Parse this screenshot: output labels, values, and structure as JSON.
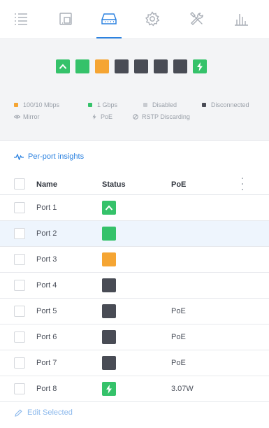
{
  "colors": {
    "accent": "#2c82e0",
    "port_100_10": "#f5a533",
    "port_1g": "#35c26a",
    "port_disabled": "#c8cbd0",
    "port_disconnected": "#494c55"
  },
  "tabs": [
    {
      "name": "list-icon",
      "active": false
    },
    {
      "name": "devices-icon",
      "active": false
    },
    {
      "name": "switch-ports-icon",
      "active": true
    },
    {
      "name": "gear-icon",
      "active": false
    },
    {
      "name": "tools-icon",
      "active": false
    },
    {
      "name": "stats-icon",
      "active": false
    }
  ],
  "overview": {
    "port_tiles": [
      {
        "state": "1g",
        "icon": "uplink-icon"
      },
      {
        "state": "1g",
        "icon": ""
      },
      {
        "state": "100_10",
        "icon": ""
      },
      {
        "state": "disconnected",
        "icon": ""
      },
      {
        "state": "disconnected",
        "icon": ""
      },
      {
        "state": "disconnected",
        "icon": ""
      },
      {
        "state": "disconnected",
        "icon": ""
      },
      {
        "state": "1g",
        "icon": "poe-bolt-icon"
      }
    ],
    "legend": {
      "speed_100_10": "100/10 Mbps",
      "speed_1g": "1 Gbps",
      "disabled": "Disabled",
      "disconnected": "Disconnected",
      "mirror": "Mirror",
      "poe": "PoE",
      "rstp": "RSTP Discarding"
    }
  },
  "insights": {
    "label": "Per-port insights"
  },
  "table": {
    "headers": {
      "name": "Name",
      "status": "Status",
      "poe": "PoE"
    },
    "rows": [
      {
        "name": "Port 1",
        "status": "1g",
        "status_icon": "uplink-icon",
        "poe": "",
        "selected": false
      },
      {
        "name": "Port 2",
        "status": "1g",
        "status_icon": "",
        "poe": "",
        "selected": true
      },
      {
        "name": "Port 3",
        "status": "100_10",
        "status_icon": "",
        "poe": "",
        "selected": false
      },
      {
        "name": "Port 4",
        "status": "disconnected",
        "status_icon": "",
        "poe": "",
        "selected": false
      },
      {
        "name": "Port 5",
        "status": "disconnected",
        "status_icon": "",
        "poe": "PoE",
        "selected": false
      },
      {
        "name": "Port 6",
        "status": "disconnected",
        "status_icon": "",
        "poe": "PoE",
        "selected": false
      },
      {
        "name": "Port 7",
        "status": "disconnected",
        "status_icon": "",
        "poe": "PoE",
        "selected": false
      },
      {
        "name": "Port 8",
        "status": "1g",
        "status_icon": "poe-bolt-icon",
        "poe": "3.07W",
        "selected": false
      }
    ]
  },
  "footer": {
    "edit_selected": "Edit Selected"
  }
}
